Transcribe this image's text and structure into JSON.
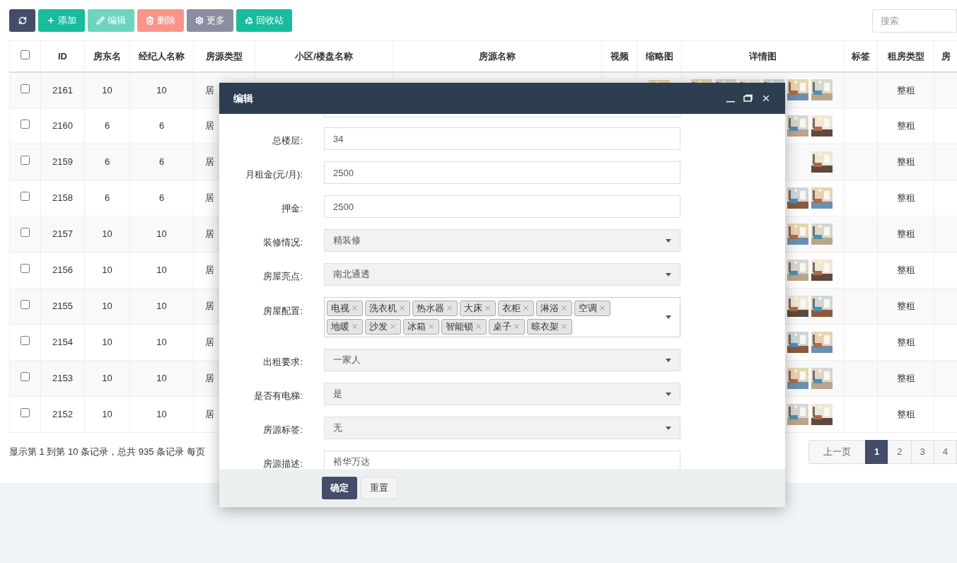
{
  "toolbar": {
    "buttons": [
      {
        "kind": "refresh",
        "disabled": false
      },
      {
        "kind": "add",
        "label": "添加",
        "disabled": false
      },
      {
        "kind": "edit",
        "label": "编辑",
        "disabled": true
      },
      {
        "kind": "delete",
        "label": "删除",
        "disabled": true
      },
      {
        "kind": "more",
        "label": "更多",
        "disabled": false
      },
      {
        "kind": "recycle",
        "label": "回收站",
        "disabled": false
      }
    ],
    "search": {
      "placeholder": "搜索"
    }
  },
  "table": {
    "header_checkbox": {
      "checked": false
    },
    "columns": [
      "ID",
      "房东名",
      "经纪人名称",
      "房源类型",
      "小区/楼盘名称",
      "房源名称",
      "视频",
      "缩略图",
      "详情图",
      "标签",
      "租房类型",
      "房"
    ],
    "rows": [
      {
        "checked": false,
        "id": "2161",
        "landlord": "10",
        "agent": "10",
        "type": "居",
        "rent_type": "整租"
      },
      {
        "checked": false,
        "id": "2160",
        "landlord": "6",
        "agent": "6",
        "type": "居",
        "rent_type": "整租"
      },
      {
        "checked": false,
        "id": "2159",
        "landlord": "6",
        "agent": "6",
        "type": "居",
        "rent_type": "整租"
      },
      {
        "checked": false,
        "id": "2158",
        "landlord": "6",
        "agent": "6",
        "type": "居",
        "rent_type": "整租"
      },
      {
        "checked": false,
        "id": "2157",
        "landlord": "10",
        "agent": "10",
        "type": "居",
        "rent_type": "整租"
      },
      {
        "checked": false,
        "id": "2156",
        "landlord": "10",
        "agent": "10",
        "type": "居",
        "rent_type": "整租"
      },
      {
        "checked": false,
        "id": "2155",
        "landlord": "10",
        "agent": "10",
        "type": "居",
        "rent_type": "整租"
      },
      {
        "checked": false,
        "id": "2154",
        "landlord": "10",
        "agent": "10",
        "type": "居",
        "rent_type": "整租"
      },
      {
        "checked": false,
        "id": "2153",
        "landlord": "10",
        "agent": "10",
        "type": "居",
        "rent_type": "整租"
      },
      {
        "checked": false,
        "id": "2152",
        "landlord": "10",
        "agent": "10",
        "type": "居",
        "rent_type": "整租"
      }
    ]
  },
  "footer": {
    "summary": "显示第 1 到第 10 条记录，总共 935 条记录 每页",
    "pagination": [
      {
        "label": "上一页",
        "selected": false
      },
      {
        "label": "1",
        "selected": true
      },
      {
        "label": "2",
        "selected": false
      },
      {
        "label": "3",
        "selected": false
      },
      {
        "label": "4",
        "selected": false
      }
    ]
  },
  "dialog": {
    "title": "编辑",
    "fields": [
      {
        "kind": "text",
        "label": "总楼层:",
        "value": "34"
      },
      {
        "kind": "text",
        "label": "月租金(元/月):",
        "value": "2500"
      },
      {
        "kind": "text",
        "label": "押金:",
        "value": "2500"
      },
      {
        "kind": "select",
        "label": "装修情况:",
        "value": "精装修"
      },
      {
        "kind": "select",
        "label": "房屋亮点:",
        "value": "南北通透"
      },
      {
        "kind": "tags",
        "label": "房屋配置:",
        "tags": [
          "电视",
          "洗衣机",
          "热水器",
          "大床",
          "衣柜",
          "淋浴",
          "空调",
          "地暖",
          "沙发",
          "冰箱",
          "智能锁",
          "桌子",
          "晾衣架"
        ]
      },
      {
        "kind": "select",
        "label": "出租要求:",
        "value": "一家人"
      },
      {
        "kind": "select",
        "label": "是否有电梯:",
        "value": "是"
      },
      {
        "kind": "select",
        "label": "房源标签:",
        "value": "无"
      },
      {
        "kind": "text",
        "label": "房源描述:",
        "value": "裕华万达"
      }
    ],
    "buttons": [
      {
        "kind": "primary",
        "label": "确定"
      },
      {
        "kind": "default",
        "label": "重置"
      }
    ]
  }
}
